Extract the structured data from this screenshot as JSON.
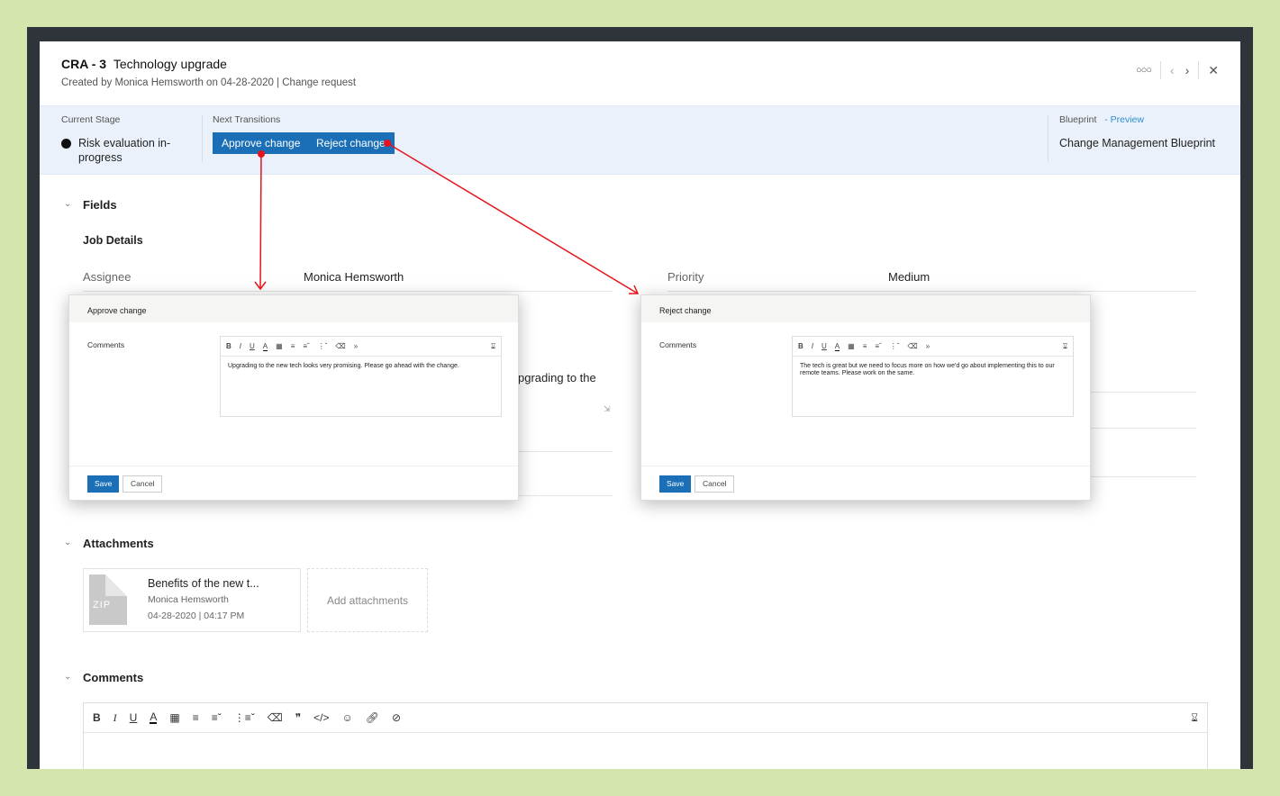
{
  "header": {
    "record_id": "CRA - 3",
    "title": "Technology upgrade",
    "subtitle": "Created by  Monica Hemsworth  on 04-28-2020 | Change request"
  },
  "stage": {
    "current_label": "Current Stage",
    "current_value": "Risk evaluation in-progress",
    "next_label": "Next Transitions",
    "approve_button": "Approve change",
    "reject_button": "Reject change",
    "blueprint_label": "Blueprint",
    "preview_link": "- Preview",
    "blueprint_value": "Change Management Blueprint"
  },
  "fields": {
    "section_title": "Fields",
    "group_title": "Job Details",
    "assignee_label": "Assignee",
    "assignee_value": "Monica Hemsworth",
    "priority_label": "Priority",
    "priority_value": "Medium",
    "description_fragment": "pgrading to the"
  },
  "approve_modal": {
    "title": "Approve change",
    "comments_label": "Comments",
    "comment_text": "Upgrading to the new tech looks very promising. Please go ahead with the change.",
    "save": "Save",
    "cancel": "Cancel"
  },
  "reject_modal": {
    "title": "Reject change",
    "comments_label": "Comments",
    "comment_text": "The tech is great but we need to focus more on how we'd go about implementing this to our remote teams. Please work on the same.",
    "save": "Save",
    "cancel": "Cancel"
  },
  "attachments": {
    "section_title": "Attachments",
    "file_name": "Benefits of the new t...",
    "file_owner": "Monica Hemsworth",
    "file_date": "04-28-2020",
    "file_time": "04:17 PM",
    "file_type": "ZIP",
    "add_label": "Add attachments"
  },
  "comments": {
    "section_title": "Comments"
  },
  "colors": {
    "accent": "#1b6fb7",
    "stage_bg": "#eaf1fa",
    "arrow": "#e5151b",
    "page_bg": "#d4e5ad"
  }
}
